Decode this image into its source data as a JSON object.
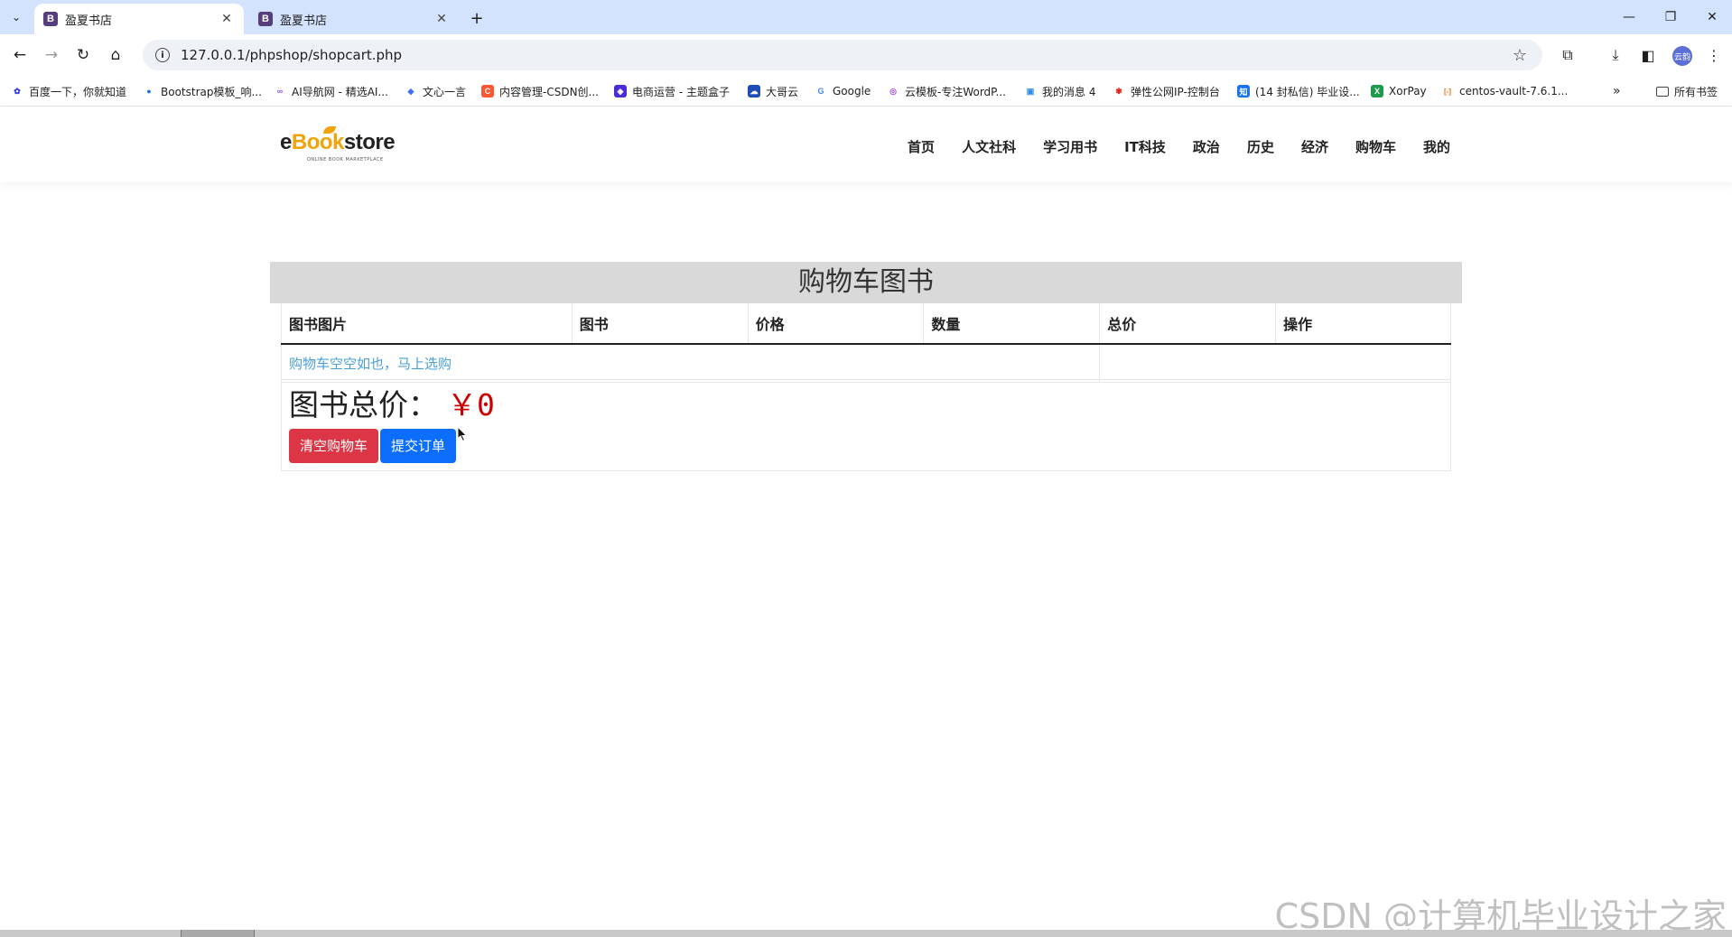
{
  "browser": {
    "tabs": [
      {
        "title": "盈夏书店",
        "favicon": "B",
        "active": true
      },
      {
        "title": "盈夏书店",
        "favicon": "B",
        "active": false
      }
    ],
    "url": "127.0.0.1/phpshop/shopcart.php",
    "bookmarks": [
      {
        "label": "百度一下，你就知道",
        "icon": "baidu-icon",
        "color": "#2932e1",
        "glyph": "✿"
      },
      {
        "label": "Bootstrap模板_响...",
        "icon": "bootstrap-icon",
        "color": "#1a73e8",
        "glyph": "●"
      },
      {
        "label": "AI导航网 - 精选AI...",
        "icon": "ai-nav-icon",
        "color": "#8a4fff",
        "glyph": "∞"
      },
      {
        "label": "文心一言",
        "icon": "wenxin-icon",
        "color": "#3b6cf6",
        "glyph": "◆"
      },
      {
        "label": "内容管理-CSDN创...",
        "icon": "csdn-icon",
        "color": "#fc5531",
        "glyph": "C"
      },
      {
        "label": "电商运营 - 主题盒子",
        "icon": "theme-box-icon",
        "color": "#4b2bd6",
        "glyph": "◈"
      },
      {
        "label": "大哥云",
        "icon": "dage-cloud-icon",
        "color": "#1e4db7",
        "glyph": "☁"
      },
      {
        "label": "Google",
        "icon": "google-icon",
        "color": "#ffffff",
        "glyph": "G"
      },
      {
        "label": "云模板-专注WordP...",
        "icon": "yunmoban-icon",
        "color": "#a24fe0",
        "glyph": "◎"
      },
      {
        "label": "我的消息 4",
        "icon": "bilibili-icon",
        "color": "#2b8de8",
        "glyph": "▣"
      },
      {
        "label": "弹性公网IP-控制台",
        "icon": "huawei-icon",
        "color": "#e1251b",
        "glyph": "✾"
      },
      {
        "label": "(14 封私信) 毕业设...",
        "icon": "zhihu-icon",
        "color": "#1772f6",
        "glyph": "知"
      },
      {
        "label": "XorPay",
        "icon": "xorpay-icon",
        "color": "#1c9c4a",
        "glyph": "X"
      },
      {
        "label": "centos-vault-7.6.1...",
        "icon": "aliyun-icon",
        "color": "#ff6a00",
        "glyph": "[-]"
      }
    ],
    "all_bookmarks": "所有书签",
    "profile": "云韵"
  },
  "site": {
    "logo": {
      "pre": "e",
      "mid": "Book",
      "post": "store",
      "tagline": "ONLINE BOOK MARKETPLACE"
    },
    "nav": [
      "首页",
      "人文社科",
      "学习用书",
      "IT科技",
      "政治",
      "历史",
      "经济",
      "购物车",
      "我的"
    ]
  },
  "cart": {
    "title": "购物车图书",
    "columns": [
      "图书图片",
      "图书",
      "价格",
      "数量",
      "总价",
      "操作"
    ],
    "empty_message": "购物车空空如也，马上选购",
    "total_label": "图书总价：",
    "total_value": "￥0",
    "clear_button": "清空购物车",
    "submit_button": "提交订单"
  },
  "watermark": "CSDN @计算机毕业设计之家",
  "colors": {
    "tabstrip": "#d3e3fd",
    "price": "#cc0000",
    "clear_button": "#dc3545",
    "submit_button": "#0d6efd",
    "empty_link": "#4a9fd8"
  }
}
